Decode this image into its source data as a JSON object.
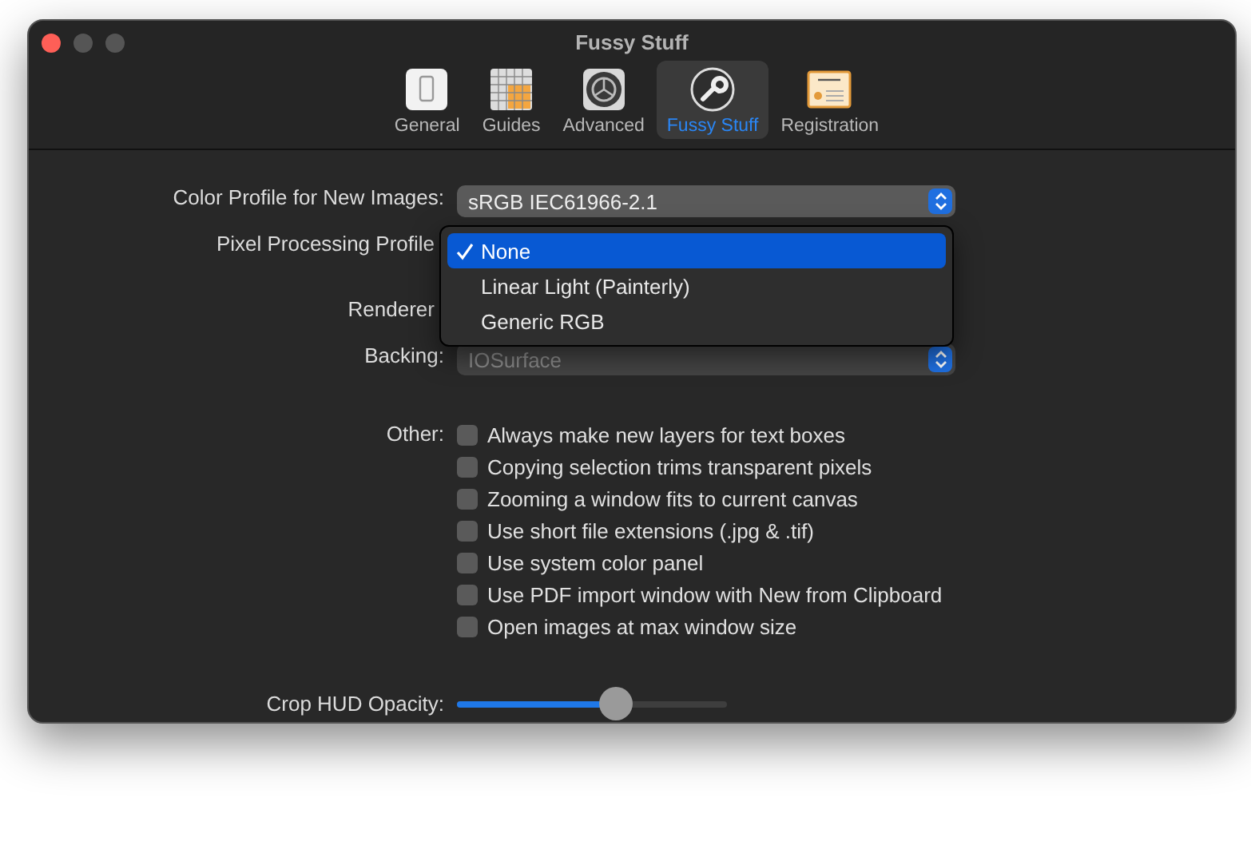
{
  "window": {
    "title": "Fussy Stuff"
  },
  "tabs": [
    {
      "label": "General",
      "selected": false
    },
    {
      "label": "Guides",
      "selected": false
    },
    {
      "label": "Advanced",
      "selected": false
    },
    {
      "label": "Fussy Stuff",
      "selected": true
    },
    {
      "label": "Registration",
      "selected": false
    }
  ],
  "settings": [
    {
      "kind": "popup",
      "label": "Color Profile for New Images:",
      "value": "sRGB IEC61966-2.1"
    },
    {
      "kind": "covered",
      "label": "Pixel Processing Profile"
    },
    {
      "kind": "covered",
      "label": "Renderer"
    },
    {
      "kind": "popup",
      "label": "Backing:",
      "value": "IOSurface",
      "disabled": true
    }
  ],
  "menu": {
    "items": [
      {
        "label": "None",
        "selected": true
      },
      {
        "label": "Linear Light (Painterly)",
        "selected": false
      },
      {
        "label": "Generic RGB",
        "selected": false
      }
    ]
  },
  "other": {
    "label": "Other:",
    "options": [
      {
        "label": "Always make new layers for text boxes",
        "checked": false
      },
      {
        "label": "Copying selection trims transparent pixels",
        "checked": false
      },
      {
        "label": "Zooming a window fits to current canvas",
        "checked": false
      },
      {
        "label": "Use short file extensions (.jpg & .tif)",
        "checked": false
      },
      {
        "label": "Use system color panel",
        "checked": false
      },
      {
        "label": "Use PDF import window with New from Clipboard",
        "checked": false
      },
      {
        "label": "Open images at max window size",
        "checked": false
      }
    ]
  },
  "slider": {
    "label": "Crop HUD Opacity:",
    "level": 0.585
  }
}
